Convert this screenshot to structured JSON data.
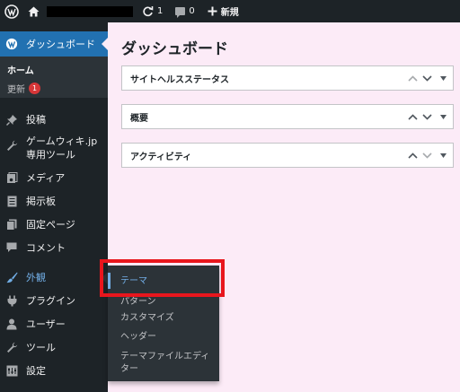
{
  "admin_bar": {
    "updates_count": "1",
    "comments_count": "0",
    "new_label": "新規"
  },
  "sidebar": {
    "dashboard_label": "ダッシュボード",
    "submenu": {
      "home_label": "ホーム",
      "updates_label": "更新",
      "updates_badge": "1"
    },
    "items": [
      {
        "label": "投稿",
        "icon": "pushpin-icon"
      },
      {
        "label": "ゲームウィキ.jp\n専用ツール",
        "icon": "wrench-icon"
      },
      {
        "label": "メディア",
        "icon": "media-icon"
      },
      {
        "label": "掲示板",
        "icon": "document-icon"
      },
      {
        "label": "固定ページ",
        "icon": "pages-icon"
      },
      {
        "label": "コメント",
        "icon": "comment-icon"
      },
      {
        "label": "外観",
        "icon": "paintbrush-icon"
      },
      {
        "label": "プラグイン",
        "icon": "plugin-icon"
      },
      {
        "label": "ユーザー",
        "icon": "user-icon"
      },
      {
        "label": "ツール",
        "icon": "wrench-icon"
      },
      {
        "label": "設定",
        "icon": "settings-icon"
      }
    ]
  },
  "main": {
    "title": "ダッシュボード",
    "postboxes": [
      {
        "title": "サイトヘルスステータス"
      },
      {
        "title": "概要"
      },
      {
        "title": "アクティビティ"
      }
    ]
  },
  "appearance_flyout": {
    "items": [
      "テーマ",
      "パターン",
      "カスタマイズ",
      "ヘッダー",
      "テーマファイルエディ\nター"
    ]
  },
  "colors": {
    "admin_bar_bg": "#1d2327",
    "sidebar_bg": "#1d2327",
    "active_menu": "#2271b1",
    "content_bg": "#fcebf7",
    "highlight_accent": "#72aee6",
    "annotation_box": "#e8161d",
    "badge_red": "#d63638"
  }
}
